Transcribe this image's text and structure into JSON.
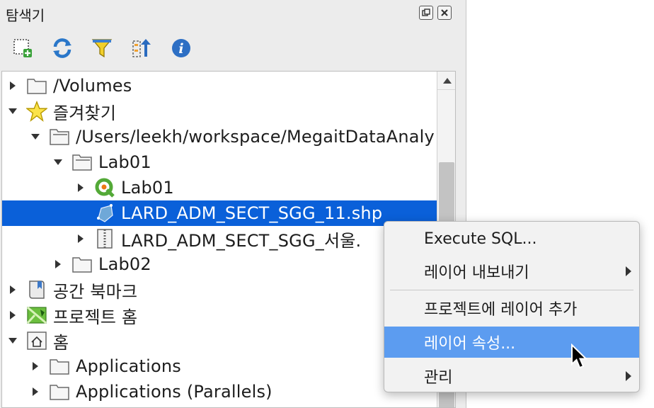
{
  "panel": {
    "title": "탐색기"
  },
  "tree": [
    {
      "label": "/Volumes",
      "icon": "folder-icon",
      "arrow": "right",
      "indent": 0
    },
    {
      "label": "즐겨찾기",
      "icon": "star-icon",
      "arrow": "down",
      "indent": 0
    },
    {
      "label": "/Users/leekh/workspace/MegaitDataAnaly",
      "icon": "folder-open-icon",
      "arrow": "down",
      "indent": 1
    },
    {
      "label": "Lab01",
      "icon": "folder-open-icon",
      "arrow": "down",
      "indent": 2
    },
    {
      "label": "Lab01",
      "icon": "qgis-project-icon",
      "arrow": "right",
      "indent": 3
    },
    {
      "label": "LARD_ADM_SECT_SGG_11.shp",
      "icon": "polygon-layer-icon",
      "arrow": "none",
      "indent": 3,
      "selected": true
    },
    {
      "label": "LARD_ADM_SECT_SGG_서울.",
      "icon": "zip-icon",
      "arrow": "right",
      "indent": 3
    },
    {
      "label": "Lab02",
      "icon": "folder-icon",
      "arrow": "right",
      "indent": 2
    },
    {
      "label": "공간 북마크",
      "icon": "bookmark-icon",
      "arrow": "right",
      "indent": 0
    },
    {
      "label": "프로젝트 홈",
      "icon": "project-home-icon",
      "arrow": "right",
      "indent": 0
    },
    {
      "label": "홈",
      "icon": "home-icon",
      "arrow": "down",
      "indent": 0
    },
    {
      "label": "Applications",
      "icon": "folder-icon",
      "arrow": "right",
      "indent": 1
    },
    {
      "label": "Applications (Parallels)",
      "icon": "folder-icon",
      "arrow": "right",
      "indent": 1
    }
  ],
  "context_menu": {
    "items": [
      {
        "label": "Execute SQL...",
        "submenu": false
      },
      {
        "label": "레이어 내보내기",
        "submenu": true
      },
      {
        "label": "프로젝트에 레이어 추가",
        "submenu": false
      },
      {
        "label": "레이어 속성...",
        "submenu": false,
        "highlighted": true
      },
      {
        "label": "관리",
        "submenu": true
      }
    ]
  },
  "colors": {
    "selection": "#0a60d9",
    "menu_highlight": "#5c9cf0"
  }
}
